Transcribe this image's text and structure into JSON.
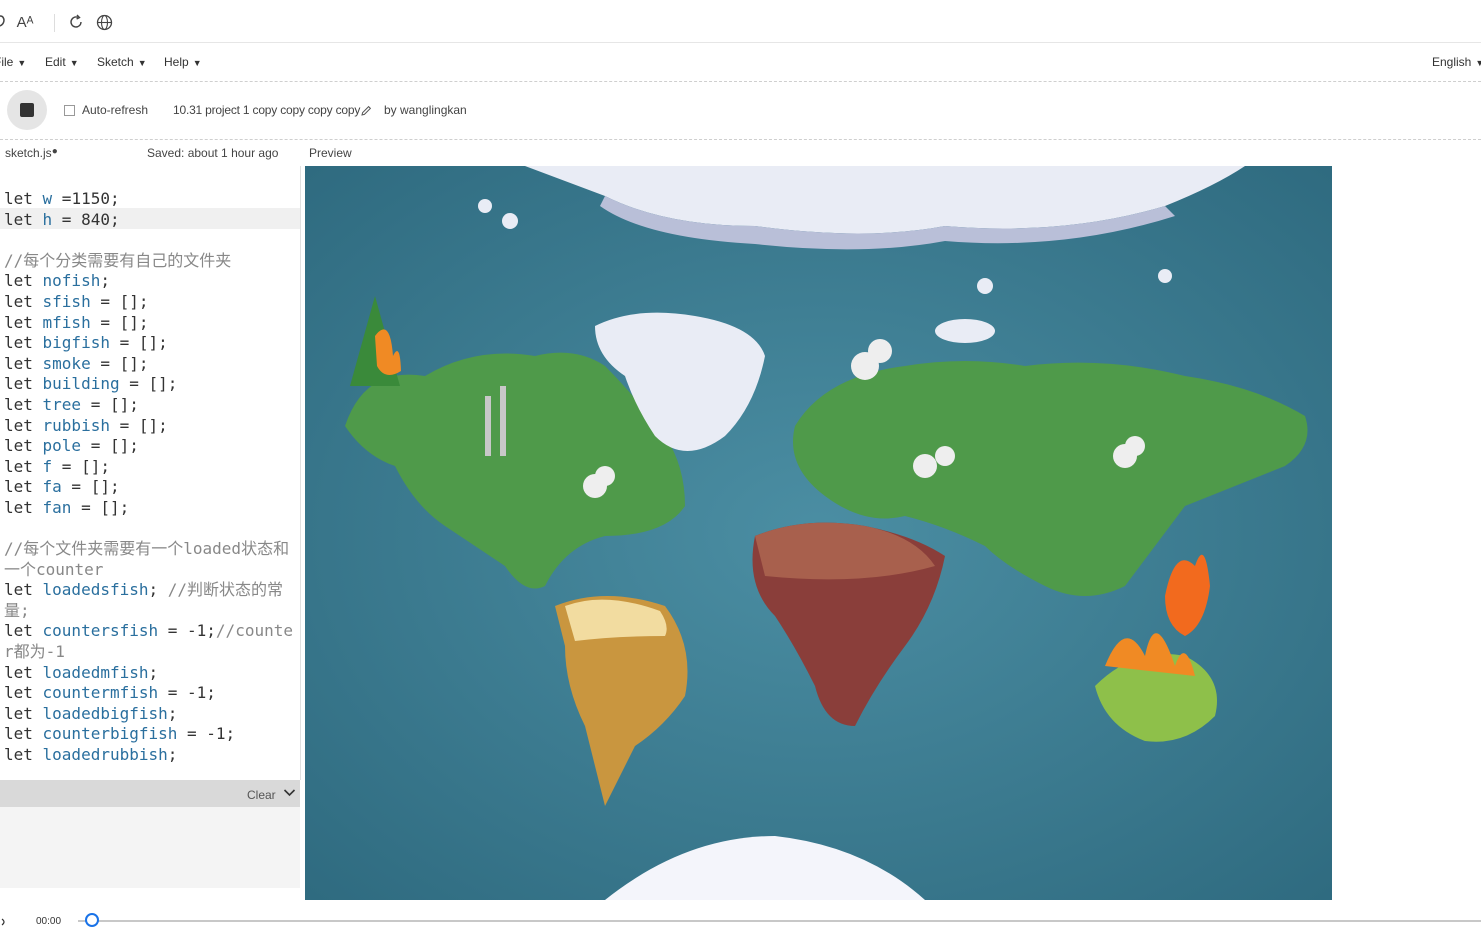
{
  "browser": {
    "icons": [
      "read-aloud-icon",
      "font-size-icon",
      "refresh-icon",
      "globe-icon"
    ],
    "font_icon_text": "Aᴬ"
  },
  "menu": {
    "items": [
      {
        "label": "File"
      },
      {
        "label": "Edit"
      },
      {
        "label": "Sketch"
      },
      {
        "label": "Help"
      }
    ],
    "language": "English"
  },
  "toolbar": {
    "auto_refresh_label": "Auto-refresh",
    "project_name": "10.31 project 1 copy copy copy copy",
    "author": "by wanglingkan"
  },
  "editor": {
    "filename": "sketch.js",
    "saved_status": "Saved: about 1 hour ago",
    "code_lines": [
      "let w =1150;",
      "let h = 840;",
      "",
      "//每个分类需要有自己的文件夹",
      "let nofish;",
      "let sfish = [];",
      "let mfish = [];",
      "let bigfish = [];",
      "let smoke = [];",
      "let building = [];",
      "let tree = [];",
      "let rubbish = [];",
      "let pole = [];",
      "let f = [];",
      "let fa = [];",
      "let fan = [];",
      "",
      "//每个文件夹需要有一个loaded状态和一个counter",
      "let loadedsfish; //判断状态的常量;",
      "let countersfish = -1;//counter都为-1",
      "let loadedmfish;",
      "let countermfish = -1;",
      "let loadedbigfish;",
      "let counterbigfish = -1;",
      "let loadedrubbish;"
    ]
  },
  "console": {
    "clear_label": "Clear"
  },
  "preview": {
    "label": "Preview"
  },
  "player": {
    "time": "00:00",
    "progress": 0.0
  },
  "colors": {
    "ocean": "#3d7e95",
    "land": "#4f9a4a",
    "ice": "#e9ecf5",
    "desert": "#c9963f"
  }
}
